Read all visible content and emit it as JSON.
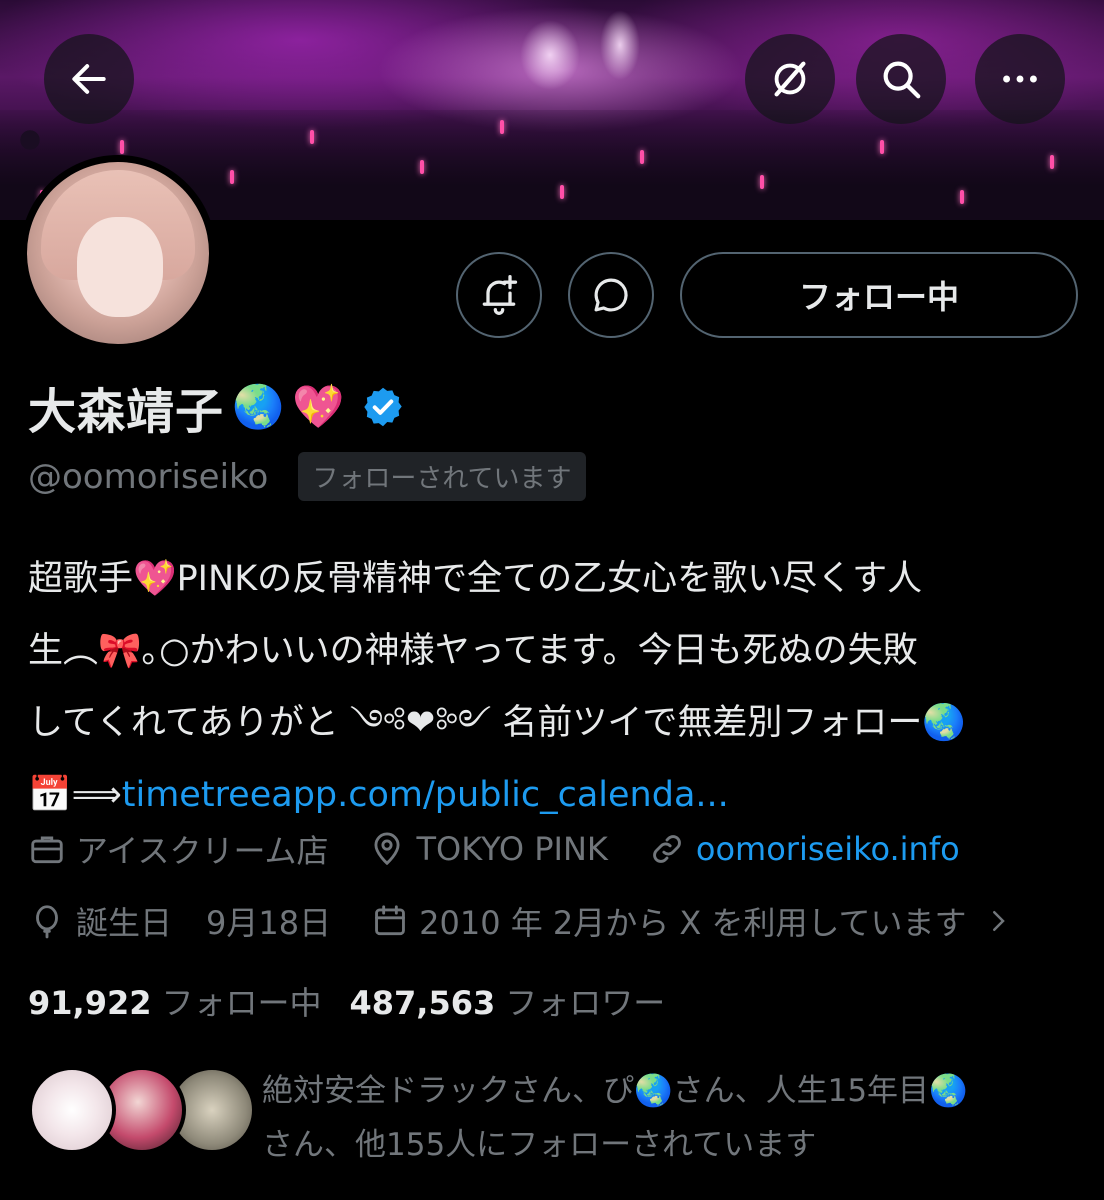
{
  "header": {
    "back_icon": "arrow-left-icon",
    "grok_icon": "grok-icon",
    "search_icon": "search-icon",
    "more_icon": "more-icon"
  },
  "profile": {
    "name": "大森靖子",
    "name_emojis": [
      "🌏",
      "💖"
    ],
    "verified_color": "#1d9bf0",
    "handle": "@oomoriseiko",
    "follows_you": "フォローされています",
    "follow_button": "フォロー中",
    "bio_lines": [
      "超歌手💖PINKの反骨精神で全ての乙女心を歌い尽くす人",
      "生︵🎀｡○かわいいの神様ヤってます。今日も死ぬの失敗",
      "してくれてありがと ༺❤︎༻ 名前ツイで無差別フォロー🌏",
      "📅⟹"
    ],
    "bio_link": "timetreeapp.com/public_calenda...",
    "occupation": "アイスクリーム店",
    "location": "TOKYO PINK",
    "website": "oomoriseiko.info",
    "birthday_label": "誕生日",
    "birthday": "9月18日",
    "joined": "2010 年 2月から X を利用しています",
    "following_count": "91,922",
    "following_label": "フォロー中",
    "followers_count": "487,563",
    "followers_label": "フォロワー",
    "followed_by_line1": "絶対安全ドラックさん、ぴ🌏さん、人生15年目🌏",
    "followed_by_line2": "さん、他155人にフォローされています"
  },
  "colors": {
    "background": "#000000",
    "text": "#e7e9ea",
    "muted": "#71767b",
    "link": "#1d9bf0",
    "border": "#536471"
  }
}
